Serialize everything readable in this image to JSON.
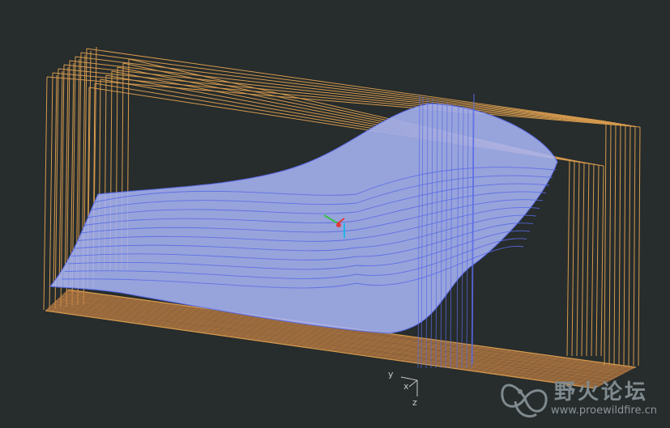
{
  "viewport": {
    "background": "#272c2c",
    "frame_color": "#d59a4e",
    "surface_fill": "#a7b4f4",
    "surface_edge": "#5a6be6",
    "grid_color": "#c68345"
  },
  "axes": {
    "x_label": "x",
    "y_label": "y",
    "z_label": "z"
  },
  "triad": {
    "x_color": "#e23a3a",
    "y_color": "#38c046",
    "z_color": "#1fb5e8"
  },
  "watermark": {
    "title": "野火论坛",
    "url": "www.proewildfire.cn",
    "icon": "butterfly-logo-icon"
  }
}
